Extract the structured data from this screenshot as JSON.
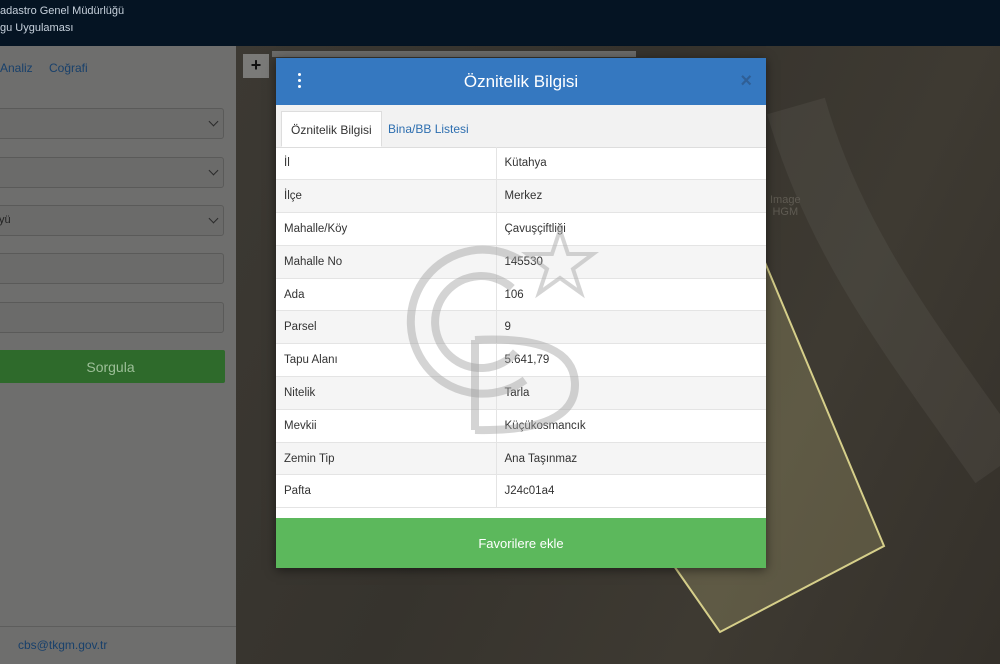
{
  "header": {
    "org_line1": "adastro Genel Müdürlüğü",
    "org_line2": "gu Uygulaması"
  },
  "sidebar": {
    "nav": [
      "Analiz",
      "Coğrafi"
    ],
    "field3_value": "yü",
    "query_button": "Sorgula",
    "email": "cbs@tkgm.gov.tr"
  },
  "map": {
    "zoom_in": "+",
    "label_line1": "Image",
    "label_line2": "HGM"
  },
  "modal": {
    "title": "Öznitelik Bilgisi",
    "close": "×",
    "tabs": [
      "Öznitelik Bilgisi",
      "Bina/BB Listesi"
    ],
    "attributes": [
      {
        "key": "İl",
        "value": "Kütahya"
      },
      {
        "key": "İlçe",
        "value": "Merkez"
      },
      {
        "key": "Mahalle/Köy",
        "value": "Çavuşçiftliği"
      },
      {
        "key": "Mahalle No",
        "value": "145530"
      },
      {
        "key": "Ada",
        "value": "106"
      },
      {
        "key": "Parsel",
        "value": "9"
      },
      {
        "key": "Tapu Alanı",
        "value": "5.641,79"
      },
      {
        "key": "Nitelik",
        "value": "Tarla"
      },
      {
        "key": "Mevkii",
        "value": "Küçükosmancık"
      },
      {
        "key": "Zemin Tip",
        "value": "Ana Taşınmaz"
      },
      {
        "key": "Pafta",
        "value": "J24c01a4"
      }
    ],
    "favorite_button": "Favorilere ekle"
  },
  "colors": {
    "header_bg": "#051423",
    "modal_header": "#3578c0",
    "favorite_green": "#5cb85c",
    "query_green": "#2e6a2b",
    "parcel_outline": "#d6cf8a"
  }
}
